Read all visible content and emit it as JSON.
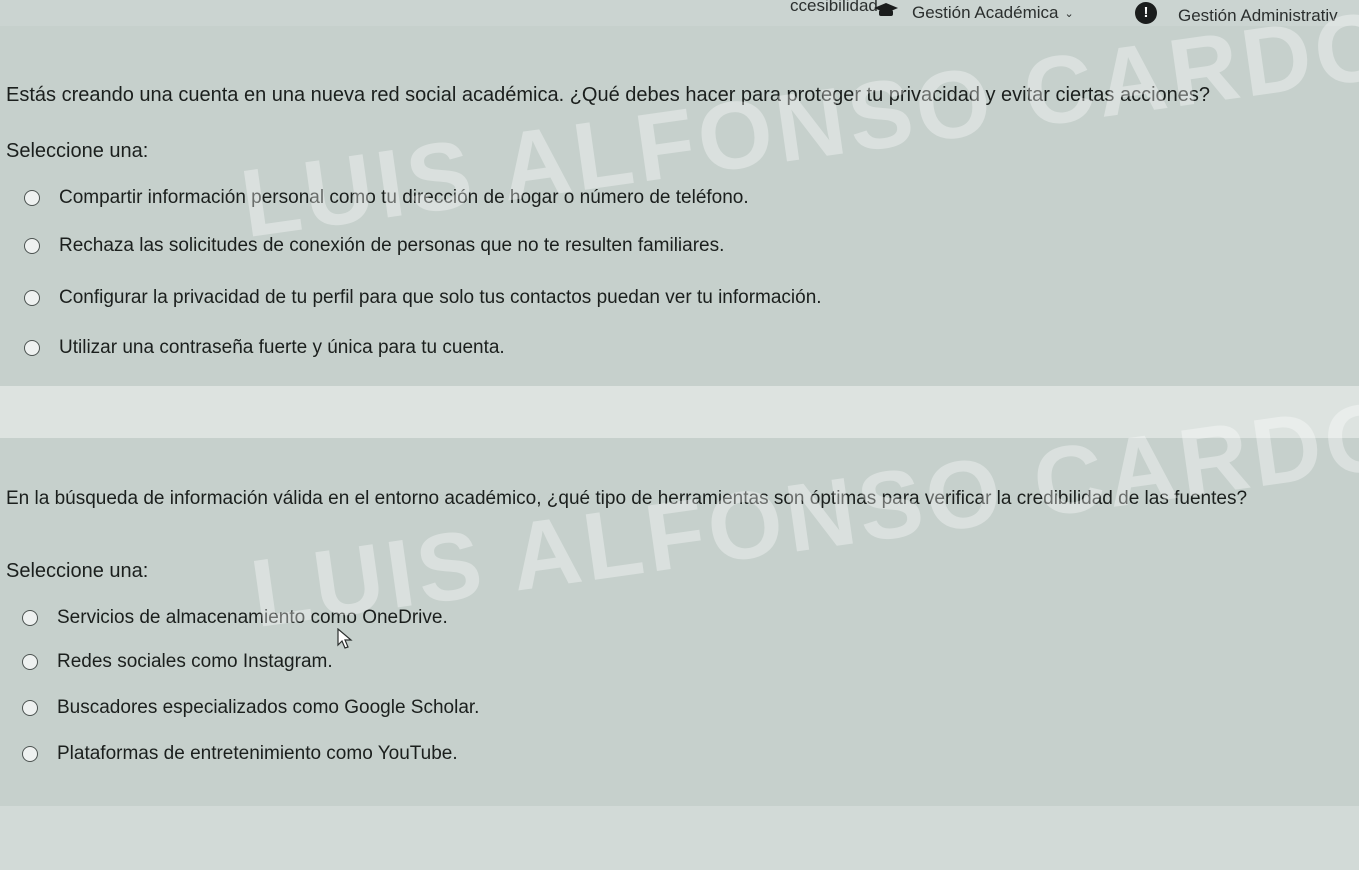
{
  "topbar": {
    "accesibilidad": "ccesibilidad",
    "gestion_academica": "Gestión Académica",
    "gestion_administrativa": "Gestión Administrativ",
    "alert_symbol": "!"
  },
  "questions": [
    {
      "text": "Estás creando una cuenta en una nueva red social académica. ¿Qué debes hacer para proteger tu privacidad y evitar ciertas acciones?",
      "prompt": "Seleccione una:",
      "options": [
        "Compartir información personal como tu dirección de hogar o número de teléfono.",
        "Rechaza las solicitudes de conexión de personas que no te resulten familiares.",
        "Configurar la privacidad de tu perfil para que solo tus contactos puedan ver tu información.",
        "Utilizar una contraseña fuerte y única para tu cuenta."
      ]
    },
    {
      "text": "En la búsqueda de información válida en el entorno académico, ¿qué tipo de herramientas son óptimas para verificar la credibilidad de las fuentes?",
      "prompt": "Seleccione una:",
      "options": [
        "Servicios de almacenamiento como OneDrive.",
        "Redes sociales como Instagram.",
        "Buscadores especializados como Google Scholar.",
        "Plataformas de entretenimiento como YouTube."
      ]
    }
  ],
  "watermark": {
    "line1": "LUIS ALFONSO CARDONA A",
    "line2": "LUIS ALFONSO CARDONA AR"
  }
}
